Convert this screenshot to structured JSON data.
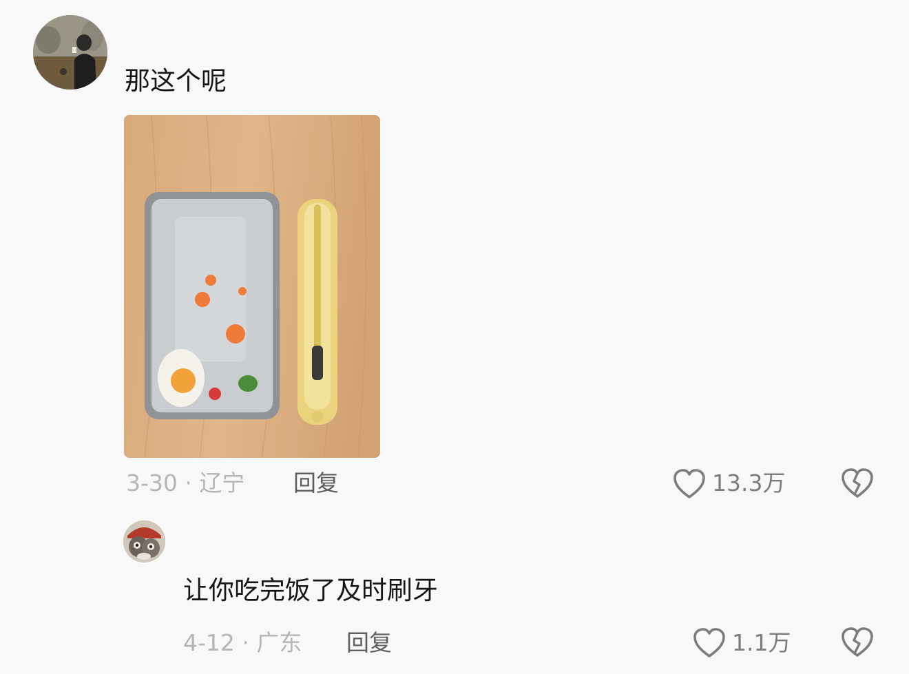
{
  "comments": [
    {
      "text": "那这个呢",
      "date_location": "3-30 · 辽宁",
      "reply_label": "回复",
      "like_count": "13.3万",
      "has_photo": true
    },
    {
      "text": "让你吃完饭了及时刷牙",
      "date_location": "4-12 · 广东",
      "reply_label": "回复",
      "like_count": "1.1万",
      "has_photo": false
    }
  ],
  "colors": {
    "background": "#f8f8f8",
    "text_primary": "#161616",
    "text_meta": "#b5b5b5",
    "text_reply": "#5e5e5e",
    "icon": "#7c7c7c"
  },
  "icons": {
    "like": "heart-outline-icon",
    "dislike": "broken-heart-icon"
  }
}
